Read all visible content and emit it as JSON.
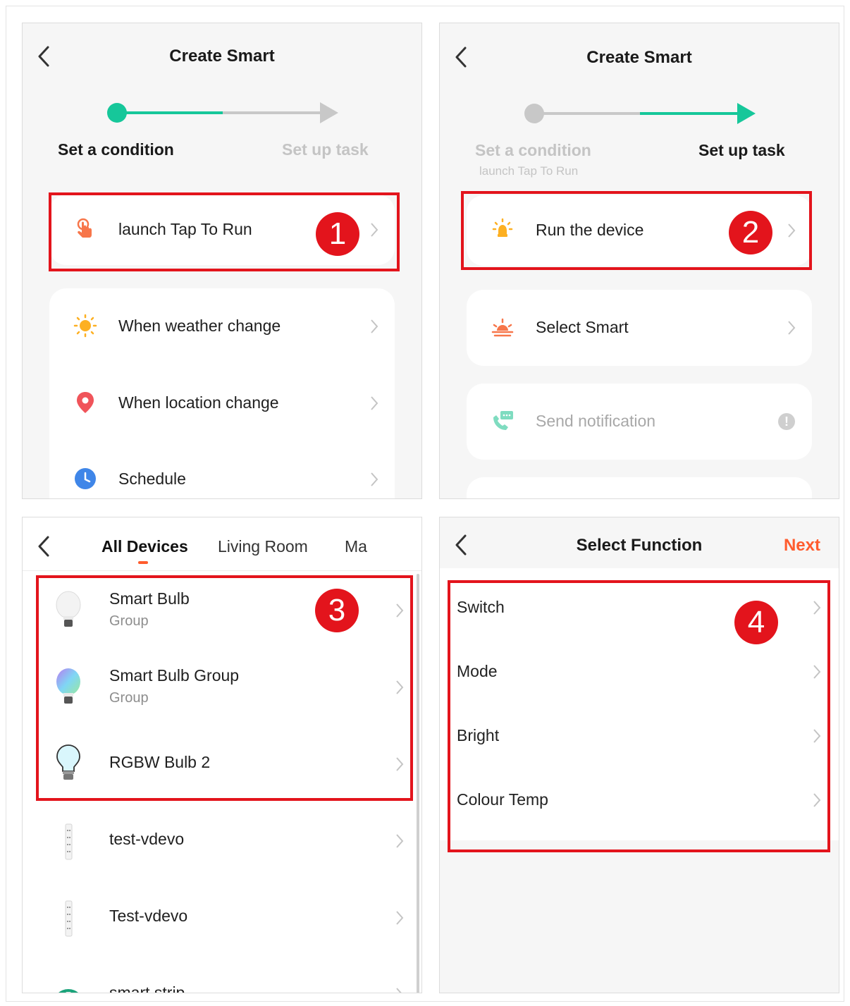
{
  "colors": {
    "accent": "#16c79a",
    "brand": "#ff5c2e",
    "highlight": "#e3141c",
    "inactive": "#c8c8c8"
  },
  "panel1": {
    "title": "Create Smart",
    "steps": [
      {
        "label": "Set a condition",
        "state": "active"
      },
      {
        "label": "Set up task",
        "state": "inactive"
      }
    ],
    "highlight_row": {
      "icon": "tap-hand-icon",
      "label": "launch Tap To Run"
    },
    "rows": [
      {
        "icon": "sun-icon",
        "label": "When weather change"
      },
      {
        "icon": "location-pin-icon",
        "label": "When location change"
      },
      {
        "icon": "clock-icon",
        "label": "Schedule"
      }
    ],
    "badge": "1"
  },
  "panel2": {
    "title": "Create Smart",
    "steps": [
      {
        "label": "Set a condition",
        "sub": "launch Tap To Run",
        "state": "done"
      },
      {
        "label": "Set up task",
        "state": "active"
      }
    ],
    "highlight_row": {
      "icon": "bulb-device-icon",
      "label": "Run the device"
    },
    "rows": [
      {
        "icon": "sunrise-icon",
        "label": "Select Smart"
      },
      {
        "icon": "notification-phone-icon",
        "label": "Send notification",
        "disabled": true
      }
    ],
    "badge": "2"
  },
  "panel3": {
    "tabs": [
      {
        "label": "All Devices",
        "active": true
      },
      {
        "label": "Living Room",
        "active": false
      },
      {
        "label": "Ma",
        "active": false
      }
    ],
    "devices": [
      {
        "name": "Smart Bulb",
        "sub": "Group",
        "icon": "white-bulb-icon"
      },
      {
        "name": "Smart Bulb Group",
        "sub": "Group",
        "icon": "rgb-bulb-icon"
      },
      {
        "name": "RGBW Bulb 2",
        "sub": "",
        "icon": "blue-bulb-icon"
      },
      {
        "name": "test-vdevo",
        "sub": "",
        "icon": "power-strip-icon"
      },
      {
        "name": "Test-vdevo",
        "sub": "",
        "icon": "power-strip-icon"
      },
      {
        "name": "smart strip",
        "sub": "",
        "icon": "smart-strip-icon"
      }
    ],
    "badge": "3"
  },
  "panel4": {
    "title": "Select Function",
    "next_label": "Next",
    "functions": [
      {
        "label": "Switch"
      },
      {
        "label": "Mode"
      },
      {
        "label": "Bright"
      },
      {
        "label": "Colour Temp"
      }
    ],
    "badge": "4"
  }
}
